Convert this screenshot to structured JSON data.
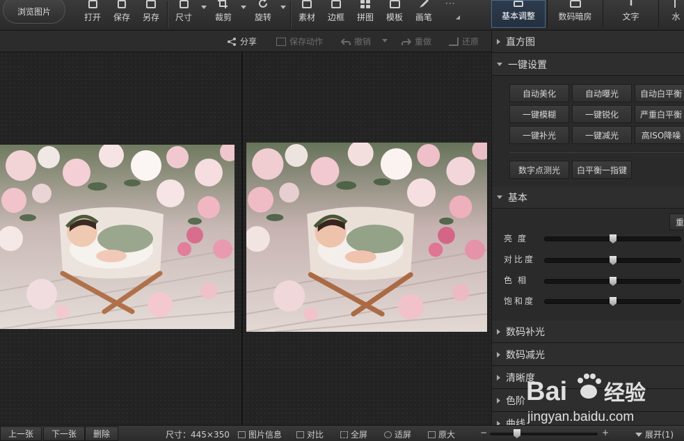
{
  "toolbar": {
    "browse_label": "浏览图片",
    "tools": [
      {
        "label": "打开",
        "icon": "open-file-icon"
      },
      {
        "label": "保存",
        "icon": "save-icon"
      },
      {
        "label": "另存",
        "icon": "save-as-icon"
      },
      {
        "label": "尺寸",
        "icon": "resize-icon"
      },
      {
        "label": "裁剪",
        "icon": "crop-icon"
      },
      {
        "label": "旋转",
        "icon": "rotate-icon"
      },
      {
        "label": "素材",
        "icon": "material-icon"
      },
      {
        "label": "边框",
        "icon": "border-icon"
      },
      {
        "label": "拼图",
        "icon": "collage-icon"
      },
      {
        "label": "模板",
        "icon": "template-icon"
      },
      {
        "label": "画笔",
        "icon": "brush-icon"
      }
    ],
    "more_icon": "more-dots-icon"
  },
  "right_tabs": [
    {
      "label": "基本调整",
      "active": true
    },
    {
      "label": "数码暗房",
      "active": false
    },
    {
      "label": "文字",
      "active": false
    },
    {
      "label": "水",
      "active": false
    }
  ],
  "subbar": {
    "share": "分享",
    "save_action": "保存动作",
    "undo": "撤销",
    "redo": "重做",
    "restore": "还原"
  },
  "panel": {
    "histogram": "直方图",
    "one_click": "一键设置",
    "one_click_buttons": [
      "自动美化",
      "自动曝光",
      "自动白平衡",
      "一键模糊",
      "一键锐化",
      "严重白平衡",
      "一键补光",
      "一键减光",
      "高ISO降噪"
    ],
    "extra_buttons": [
      "数字点测光",
      "白平衡一指键"
    ],
    "basic": "基本",
    "reset_label": "重",
    "sliders": [
      {
        "label": "亮度",
        "value": 50
      },
      {
        "label": "对比度",
        "value": 50
      },
      {
        "label": "色相",
        "value": 50
      },
      {
        "label": "饱和度",
        "value": 50
      }
    ],
    "collapsed_sections": [
      "数码补光",
      "数码减光",
      "清晰度",
      "色阶",
      "曲线"
    ]
  },
  "bottombar": {
    "prev": "上一张",
    "next": "下一张",
    "delete": "删除",
    "size_text": "尺寸：445×350",
    "info": "图片信息",
    "compare": "对比",
    "fullscreen": "全屏",
    "fit": "适屏",
    "original": "原大",
    "zoom_minus": "−",
    "zoom_plus": "+",
    "zoom_fraction": 0.25,
    "expand": "展开(1)"
  },
  "watermark": {
    "brand_latin": "Bai",
    "brand_cn": "经验",
    "url": "jingyan.baidu.com"
  },
  "colors": {
    "accent_blue": "#4c6a8f",
    "background": "#262626",
    "panel": "#2a2a2a"
  }
}
